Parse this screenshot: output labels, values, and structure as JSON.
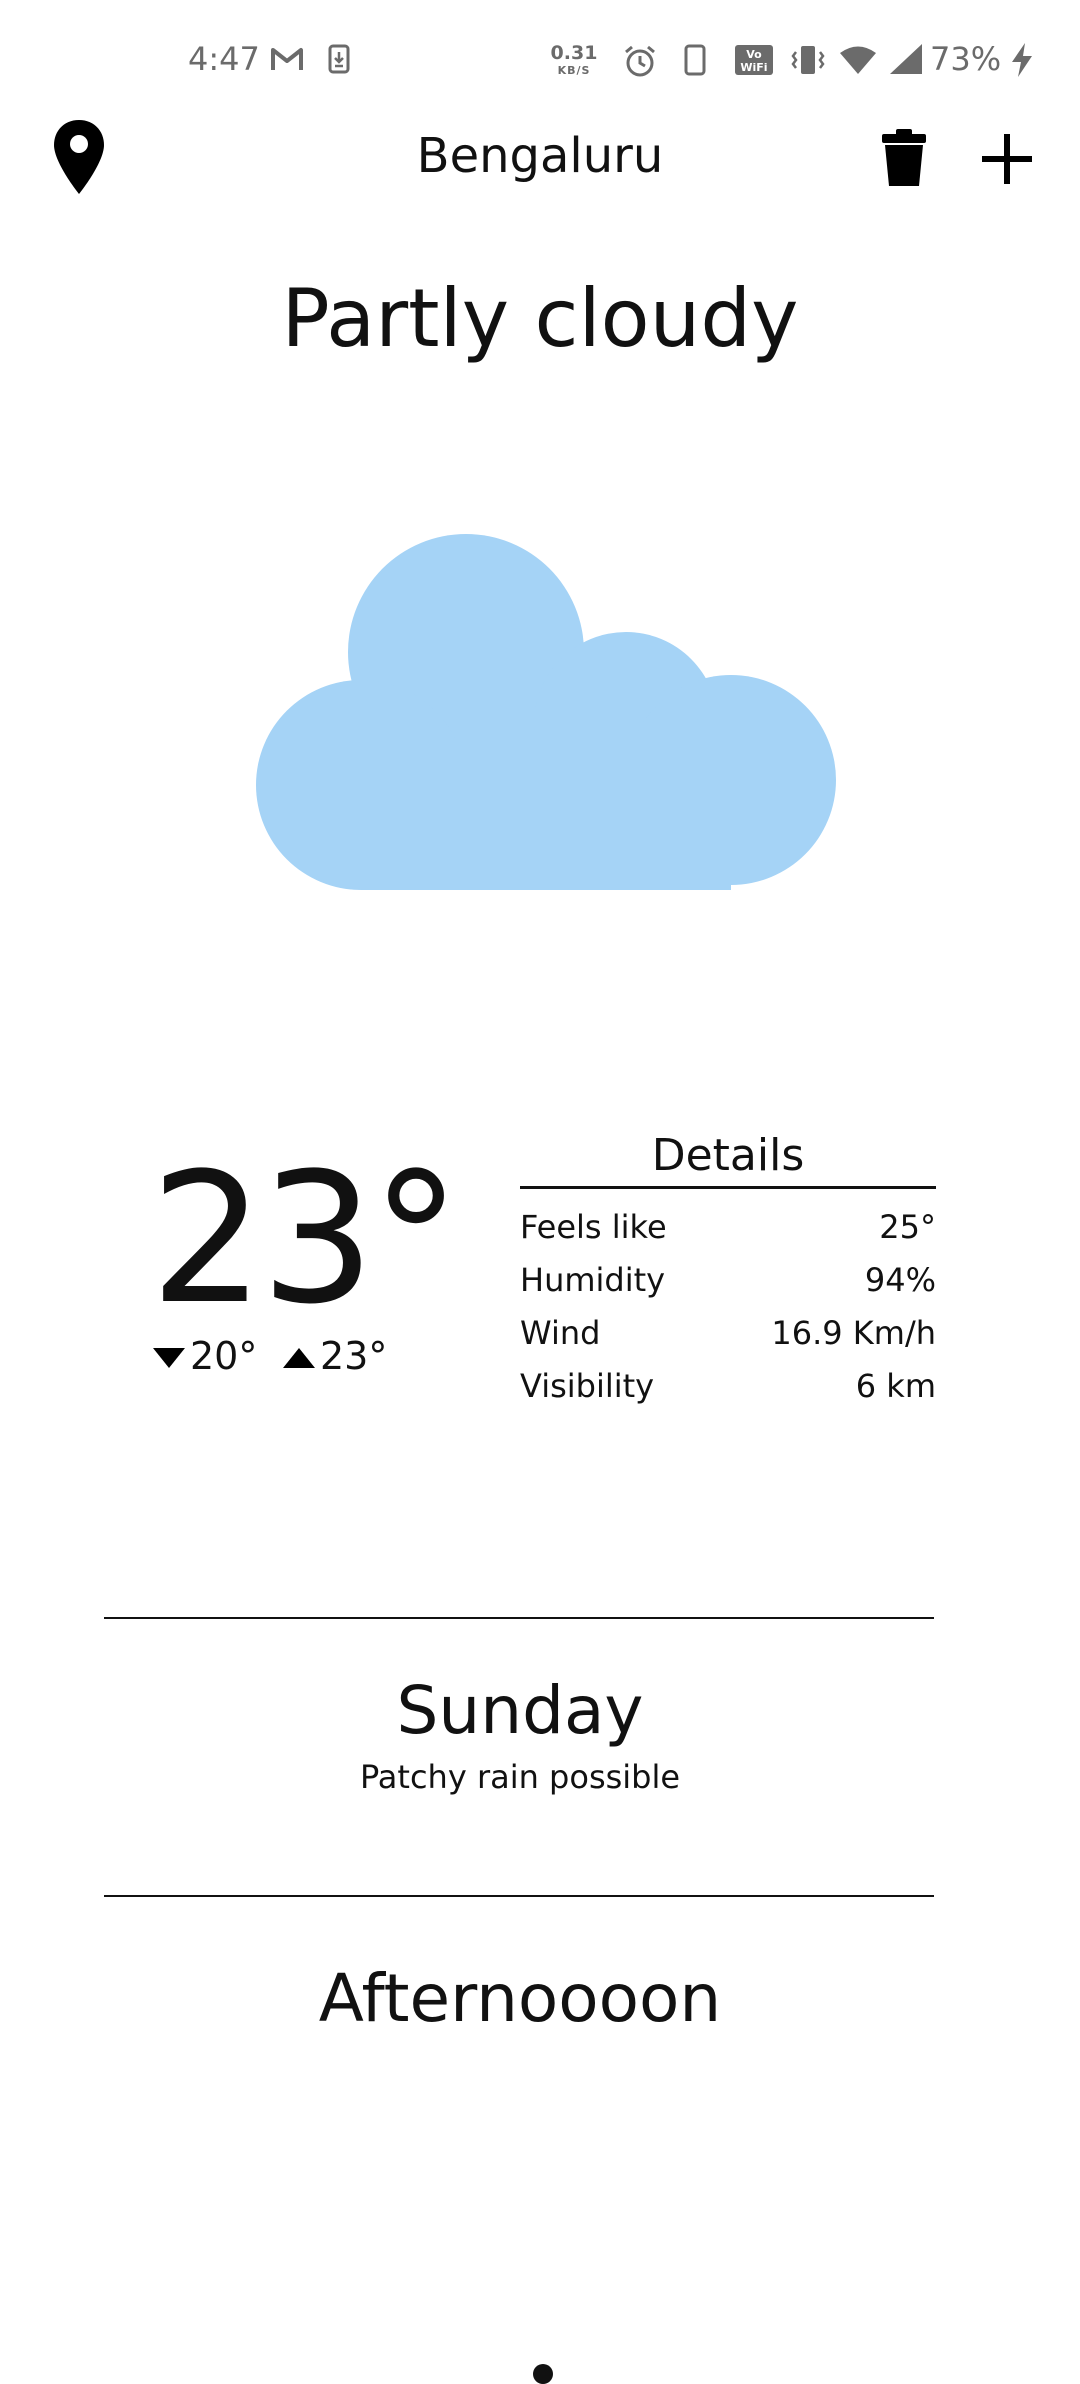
{
  "status_bar": {
    "time": "4:47",
    "net_speed_value": "0.31",
    "net_speed_unit": "KB/S",
    "battery_percent": "73%",
    "icons": [
      "gmail-icon",
      "download-icon",
      "alarm-icon",
      "phone-icon",
      "vowifi-icon",
      "vibrate-icon",
      "wifi-icon",
      "signal-icon",
      "charging-icon"
    ]
  },
  "app_bar": {
    "location_icon": "location-pin-icon",
    "city": "Bengaluru",
    "delete_icon": "trash-icon",
    "add_icon": "plus-icon"
  },
  "weather": {
    "condition": "Partly cloudy",
    "illustration": "cloud-icon",
    "cloud_color": "#A5D3F6",
    "temperature": "23°",
    "min_temp": "20°",
    "max_temp": "23°"
  },
  "details": {
    "title": "Details",
    "rows": [
      {
        "label": "Feels like",
        "value": "25°"
      },
      {
        "label": "Humidity",
        "value": "94%"
      },
      {
        "label": "Wind",
        "value": "16.9 Km/h"
      },
      {
        "label": "Visibility",
        "value": "6 km"
      }
    ]
  },
  "forecast": {
    "day": "Sunday",
    "day_condition": "Patchy rain possible",
    "section_title": "Afternoooon"
  },
  "pager": {
    "active_page": 1
  }
}
